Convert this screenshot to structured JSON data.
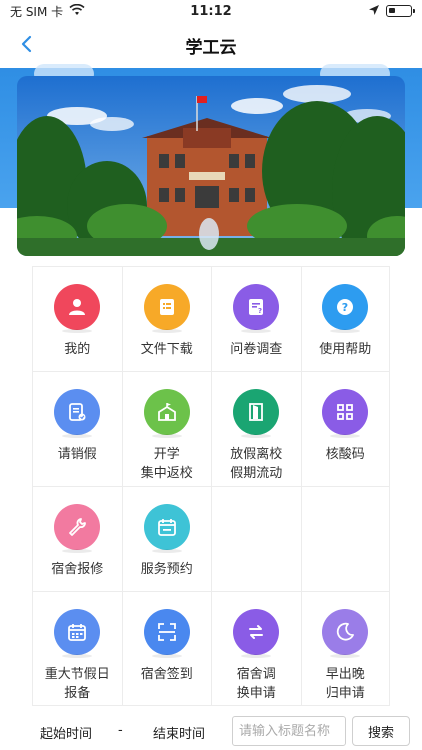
{
  "status_bar": {
    "carrier": "无 SIM 卡",
    "time": "11:12"
  },
  "nav": {
    "title": "学工云"
  },
  "colors": {
    "accent": "#2f8ee4"
  },
  "grid": {
    "rows": [
      [
        {
          "label": "我的",
          "icon": "person-icon",
          "color": "#f0475c"
        },
        {
          "label": "文件下载",
          "icon": "file-list-icon",
          "color": "#f7a928"
        },
        {
          "label": "问卷调查",
          "icon": "survey-icon",
          "color": "#8a5ce6"
        },
        {
          "label": "使用帮助",
          "icon": "help-icon",
          "color": "#2d9cf0"
        }
      ],
      [
        {
          "label": "请销假",
          "icon": "leave-form-icon",
          "color": "#5b8ef0"
        },
        {
          "label": "开学\n集中返校",
          "icon": "school-icon",
          "color": "#6cc24a"
        },
        {
          "label": "放假离校\n假期流动",
          "icon": "exit-door-icon",
          "color": "#1aa572"
        },
        {
          "label": "核酸码",
          "icon": "qr-grid-icon",
          "color": "#8a5ce6"
        }
      ],
      [
        {
          "label": "宿舍报修",
          "icon": "wrench-icon",
          "color": "#f27aa0"
        },
        {
          "label": "服务预约",
          "icon": "calendar-icon",
          "color": "#3ec3d6"
        },
        null,
        null
      ],
      [
        {
          "label": "重大节假日\n报备",
          "icon": "calendar-report-icon",
          "color": "#5b8ef0"
        },
        {
          "label": "宿舍签到",
          "icon": "scan-icon",
          "color": "#4a88ef"
        },
        {
          "label": "宿舍调\n换申请",
          "icon": "swap-icon",
          "color": "#8a5ce6"
        },
        {
          "label": "早出晚\n归申请",
          "icon": "moon-icon",
          "color": "#9a7de8"
        }
      ]
    ]
  },
  "filter": {
    "start_label": "起始时间",
    "dash": "-",
    "end_label": "结束时间",
    "search_placeholder": "请输入标题名称",
    "search_button": "搜索"
  }
}
